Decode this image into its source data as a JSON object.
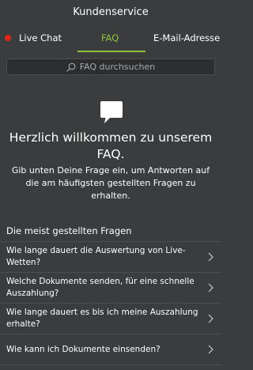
{
  "header": {
    "title": "Kundenservice"
  },
  "tabs": [
    {
      "label": "Live Chat",
      "status_color": "#e0261b"
    },
    {
      "label": "FAQ",
      "active": true,
      "color": "#8cc63f"
    },
    {
      "label": "E-Mail-Adresse"
    }
  ],
  "search": {
    "placeholder": "FAQ durchsuchen",
    "icon": "search-icon"
  },
  "welcome": {
    "icon": "chat-bubble-icon",
    "title": "Herzlich willkommen zu unserem FAQ.",
    "text": "Gib unten Deine Frage ein, um Antworten auf die am häufigsten gestellten Fragen zu erhalten."
  },
  "faq": {
    "section_title": "Die meist gestellten Fragen",
    "items": [
      {
        "question": "Wie lange dauert die Auswertung von Live-Wetten?"
      },
      {
        "question": "Welche Dokumente senden, für eine schnelle Auszahlung?"
      },
      {
        "question": "Wie lange dauert es bis ich meine Auszahlung erhalte?"
      },
      {
        "question": "Wie kann ich Dokumente einsenden?"
      }
    ]
  },
  "colors": {
    "background": "#3a3c3d",
    "accent": "#8cc63f",
    "live_dot": "#e0261b"
  }
}
